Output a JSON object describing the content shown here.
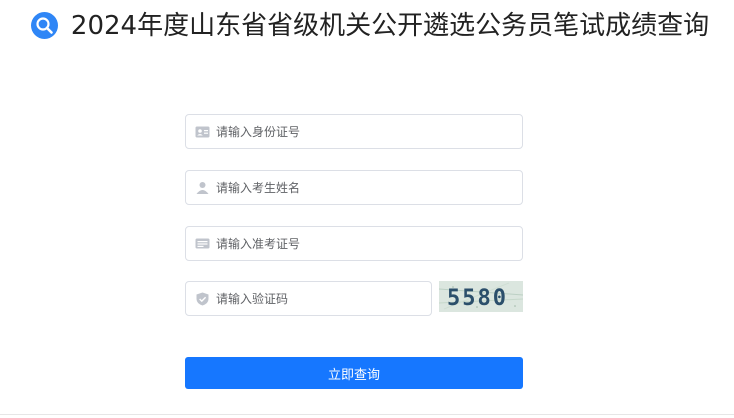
{
  "header": {
    "title": "2024年度山东省省级机关公开遴选公务员笔试成绩查询",
    "icon": "search-icon",
    "icon_color": "#2f86f6"
  },
  "form": {
    "id_card": {
      "placeholder": "请输入身份证号",
      "icon": "id-card-icon"
    },
    "name": {
      "placeholder": "请输入考生姓名",
      "icon": "user-icon"
    },
    "ticket": {
      "placeholder": "请输入准考证号",
      "icon": "ticket-icon"
    },
    "captcha": {
      "placeholder": "请输入验证码",
      "icon": "shield-icon",
      "image_text": "5580"
    }
  },
  "submit_label": "立即查询",
  "colors": {
    "primary": "#1677ff",
    "border": "#dcdfe6",
    "placeholder": "#606266"
  }
}
